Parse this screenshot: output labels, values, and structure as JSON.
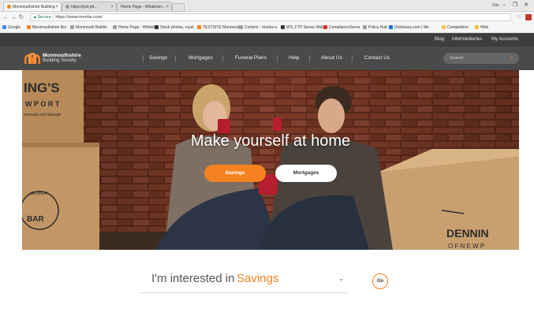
{
  "browser": {
    "tabs": [
      {
        "title": "Monmouthshire Building",
        "active": true
      },
      {
        "title": "https://prd-ph...",
        "active": false
      },
      {
        "title": "Home Page - Whatever...",
        "active": false
      }
    ],
    "user_name": "Ritu",
    "window_controls": [
      "–",
      "❐",
      "✕"
    ],
    "secure_label": "Secure",
    "url": "https://www.monbs.com/",
    "bookmarks": [
      "Google",
      "Monmouthshire Bui",
      "Monmouth Buildin",
      "Home Page - Whitsh",
      "Stock photos, royal",
      "TESTSITE Monmouth",
      "Content - monbs-u",
      "WS_FTP Server Web",
      "ComplianceServe",
      "Policy Hub",
      "Dictionary.com | Me",
      "Competitors",
      "Web"
    ]
  },
  "site": {
    "utility_links": [
      "Blog",
      "Intermediaries",
      "My Accounts"
    ],
    "logo": {
      "line1": "Monmouthshire",
      "line2": "Building Society"
    },
    "nav": [
      "Savings",
      "Mortgages",
      "Funeral Plans",
      "Help",
      "About Us",
      "Contact Us"
    ],
    "search_placeholder": "Search",
    "hero": {
      "headline": "Make yourself at home",
      "primary_button": "Savings",
      "secondary_button": "Mortgages"
    },
    "interest": {
      "prefix": "I'm interested in",
      "selected": "Savings",
      "go_label": "Go"
    },
    "brand_colors": {
      "orange": "#f58220",
      "header": "#4a4a4a",
      "topbar": "#3d3d3d"
    }
  }
}
